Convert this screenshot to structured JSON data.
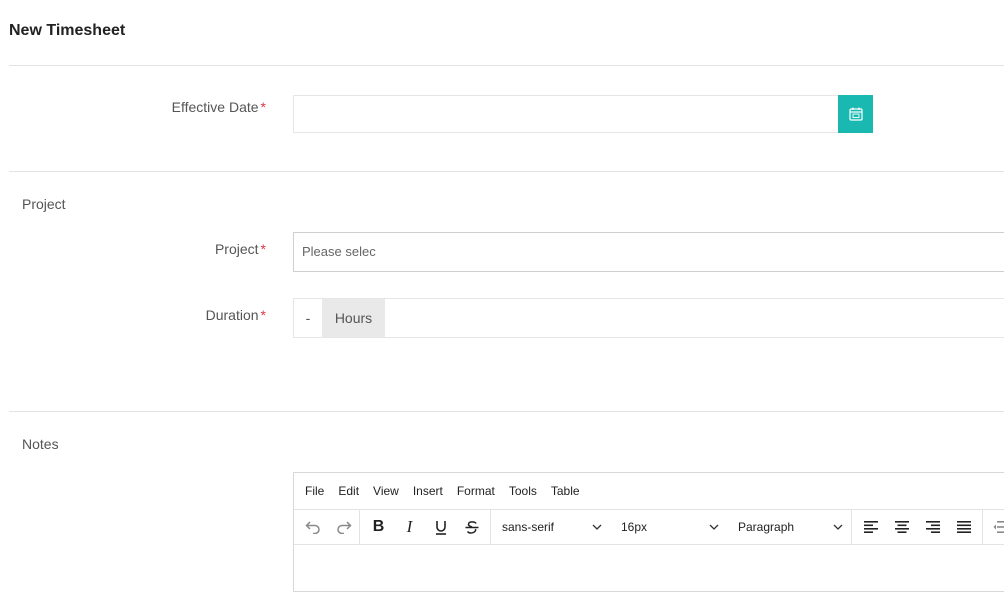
{
  "page": {
    "title": "New Timesheet"
  },
  "form": {
    "effective_date": {
      "label": "Effective Date",
      "required": "*",
      "value": ""
    },
    "project_section": {
      "title": "Project"
    },
    "project": {
      "label": "Project",
      "required": "*",
      "placeholder": "Please selec"
    },
    "duration": {
      "label": "Duration",
      "required": "*",
      "value": "-",
      "unit": "Hours"
    },
    "notes_section": {
      "title": "Notes"
    }
  },
  "editor": {
    "menu": [
      "File",
      "Edit",
      "View",
      "Insert",
      "Format",
      "Tools",
      "Table"
    ],
    "font_family": "sans-serif",
    "font_size": "16px",
    "block_format": "Paragraph"
  },
  "colors": {
    "accent": "#19b8b0",
    "required": "#e03546"
  },
  "icons": {
    "calendar": "calendar-icon",
    "undo": "undo-icon",
    "redo": "redo-icon",
    "bold": "bold-icon",
    "italic": "italic-icon",
    "underline": "underline-icon",
    "strikethrough": "strikethrough-icon",
    "align_left": "align-left-icon",
    "align_center": "align-center-icon",
    "align_right": "align-right-icon",
    "justify": "justify-icon",
    "outdent": "outdent-icon"
  }
}
